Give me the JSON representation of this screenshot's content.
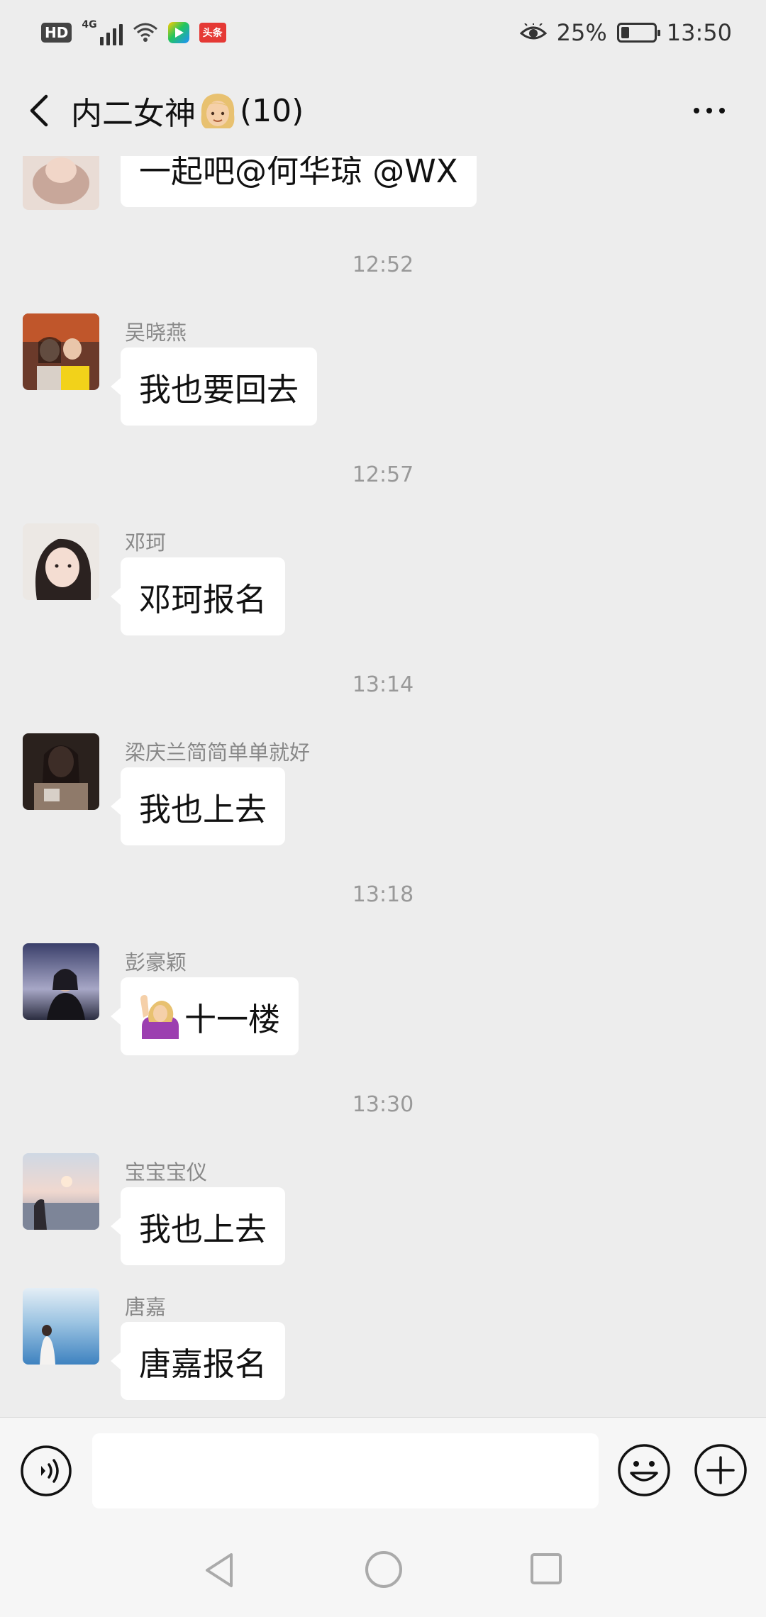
{
  "status_bar": {
    "hd": "HD",
    "network": "4G",
    "app_badge": "头条",
    "battery_percent": "25%",
    "battery_level": 0.25,
    "time": "13:50"
  },
  "header": {
    "title_prefix": "内二女神",
    "title_suffix": "(10)"
  },
  "messages": [
    {
      "type": "message",
      "sender": "",
      "text": "一起吧@何华琼  @WX"
    },
    {
      "type": "time",
      "text": "12:52"
    },
    {
      "type": "message",
      "sender": "吴晓燕",
      "text": "我也要回去"
    },
    {
      "type": "time",
      "text": "12:57"
    },
    {
      "type": "message",
      "sender": "邓珂",
      "text": "邓珂报名"
    },
    {
      "type": "time",
      "text": "13:14"
    },
    {
      "type": "message",
      "sender": "梁庆兰简简单单就好",
      "text": "我也上去"
    },
    {
      "type": "time",
      "text": "13:18"
    },
    {
      "type": "message",
      "sender": "彭豪颖",
      "text": "十一楼"
    },
    {
      "type": "time",
      "text": "13:30"
    },
    {
      "type": "message",
      "sender": "宝宝宝仪",
      "text": "我也上去"
    },
    {
      "type": "message",
      "sender": "唐嘉",
      "text": "唐嘉报名"
    }
  ],
  "input": {
    "value": "",
    "placeholder": ""
  },
  "icons": {
    "back": "back-arrow-icon",
    "more": "more-icon",
    "voice": "voice-icon",
    "emoji": "emoji-icon",
    "plus": "plus-icon"
  }
}
